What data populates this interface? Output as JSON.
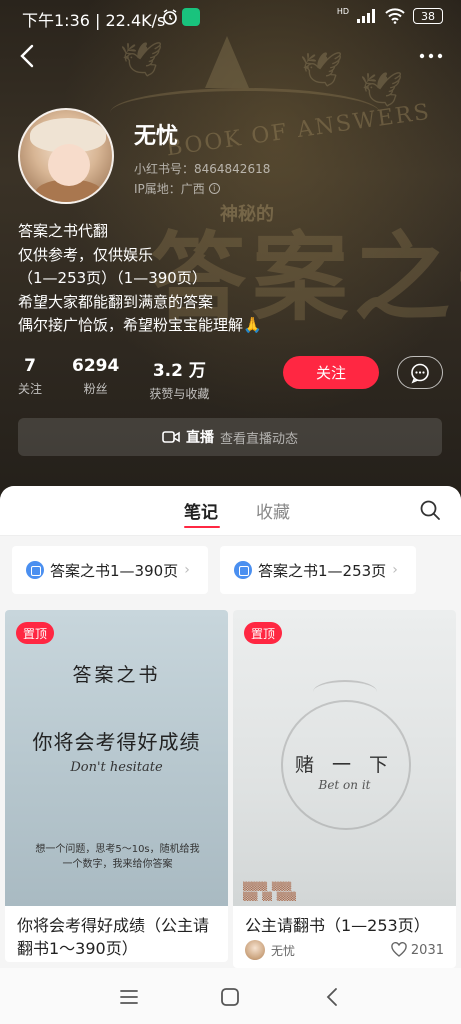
{
  "status_bar": {
    "time_speed": "下午1:36 | 22.4K/s",
    "battery": "38",
    "signal_label": "HD"
  },
  "profile": {
    "nickname": "无忧",
    "red_id": "小红书号：8464842618",
    "ip": "IP属地：广西",
    "bio_lines": [
      "答案之书代翻",
      "仅供参考，仅供娱乐",
      "（1—253页）（1—390页）",
      "希望大家都能翻到满意的答案",
      "偶尔接广恰饭，希望粉宝宝能理解🙏"
    ],
    "stats": [
      {
        "num": "7",
        "label": "关注"
      },
      {
        "num": "6294",
        "label": "粉丝"
      },
      {
        "num": "3.2 万",
        "label": "获赞与收藏"
      }
    ],
    "follow_label": "关注",
    "live_label": "直播",
    "live_sub": "查看直播动态"
  },
  "hero_bg": {
    "book_text": "BOOK OF ANSWERS",
    "mystery_text": "神秘的",
    "big_text": "答案之书"
  },
  "tabs": {
    "notes": "笔记",
    "collect": "收藏"
  },
  "collections": [
    {
      "label": "答案之书1—390页"
    },
    {
      "label": "答案之书1—253页"
    }
  ],
  "cards": [
    {
      "pin": "置顶",
      "cover_title": "答案之书",
      "cover_main": "你将会考得好成绩",
      "cover_en": "Don't hesitate",
      "cover_note": "想一个问题，思考5～10s，随机给我一个数字，我来给你答案",
      "title": "你将会考得好成绩（公主请翻书1～390页）"
    },
    {
      "pin": "置顶",
      "cover_main": "赌 一 下",
      "cover_en": "Bet on it",
      "title": "公主请翻书（1—253页）",
      "author": "无忧",
      "likes": "2031"
    }
  ],
  "colors": {
    "accent": "#ff2742",
    "chip_icon": "#4a8ff0"
  }
}
